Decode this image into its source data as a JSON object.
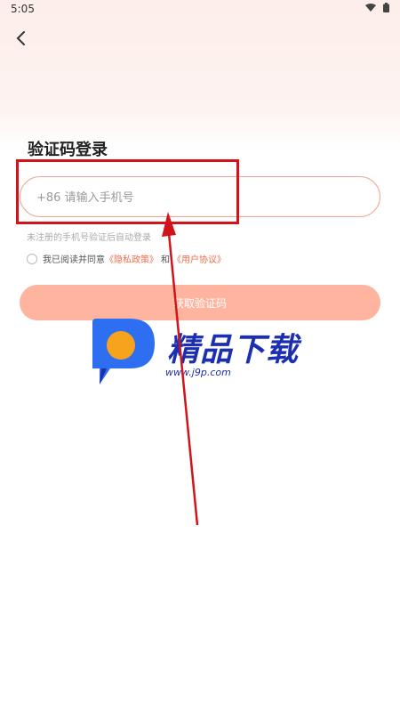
{
  "status_bar": {
    "time": "5:05",
    "icons": [
      "wifi-icon",
      "battery-icon"
    ]
  },
  "header": {
    "back_icon": "back-arrow-icon"
  },
  "login": {
    "title": "验证码登录",
    "phone_placeholder": "+86 请输入手机号",
    "hint": "未注册的手机号验证后自动登录",
    "agree_prefix": "我已阅读并同意",
    "privacy_link": "《隐私政策》",
    "and_text": "和",
    "user_link": "《用户协议》",
    "get_code_button": "获取验证码"
  },
  "watermark": {
    "title": "精品下载",
    "url": "www.j9p.com"
  },
  "colors": {
    "accent": "#f26b4a",
    "button_bg": "#ffb49f",
    "input_border": "#f4a592",
    "annotation_red": "#d0141a",
    "watermark_blue": "#1b2fb0"
  }
}
